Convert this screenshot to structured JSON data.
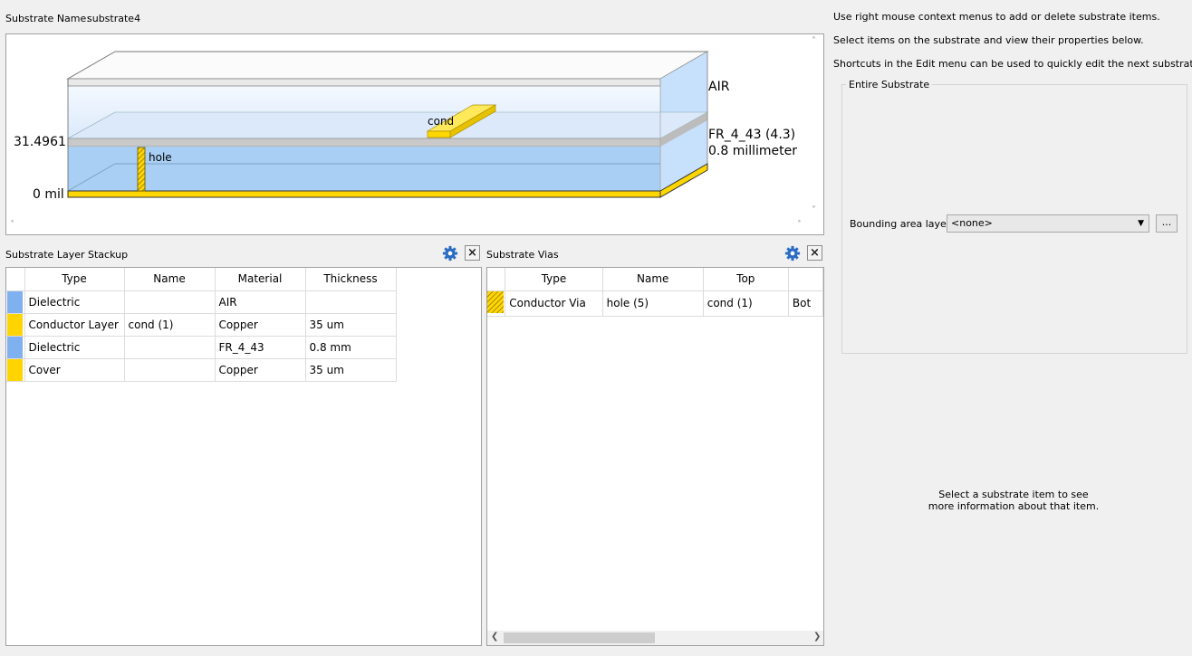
{
  "substrate_name_label": "Substrate Name:",
  "substrate_name": "substrate4",
  "viewer": {
    "layers": {
      "air": "AIR",
      "fr4": "FR_4_43 (4.3)",
      "fr4_thickness": "0.8 millimeter"
    },
    "axis": {
      "top": "31.4961",
      "bottom": "0 mil"
    },
    "items": {
      "cond": "cond",
      "hole": "hole"
    },
    "colors": {
      "conductor": "#ffd700",
      "dielectric": "#a9cff5",
      "air": "#e8f2fd"
    }
  },
  "hints": [
    "Use right mouse context menus to add or delete substrate items.",
    "Select items on the substrate and view their properties below.",
    "Shortcuts in the Edit menu can be used to quickly edit the next substrate item."
  ],
  "stackup": {
    "title": "Substrate Layer Stackup",
    "columns": [
      "Type",
      "Name",
      "Material",
      "Thickness"
    ],
    "rows": [
      {
        "color": "#7fb0f0",
        "type": "Dielectric",
        "name": "",
        "material": "AIR",
        "thickness": ""
      },
      {
        "color": "#ffd400",
        "type": "Conductor Layer",
        "name": "cond (1)",
        "material": "Copper",
        "thickness": "35 um"
      },
      {
        "color": "#7fb0f0",
        "type": "Dielectric",
        "name": "",
        "material": "FR_4_43",
        "thickness": "0.8 mm"
      },
      {
        "color": "#ffd400",
        "type": "Cover",
        "name": "",
        "material": "Copper",
        "thickness": "35 um"
      }
    ]
  },
  "vias": {
    "title": "Substrate Vias",
    "columns": [
      "Type",
      "Name",
      "Top",
      "Bot"
    ],
    "rows": [
      {
        "type": "Conductor Via",
        "name": "hole (5)",
        "top": "cond (1)",
        "bottom": "Bot"
      }
    ]
  },
  "properties": {
    "group_title": "Entire Substrate",
    "bounding_label": "Bounding area layer:",
    "bounding_value": "<none>",
    "browse_label": "...",
    "info_line1": "Select a substrate item to see",
    "info_line2": "more information about that item."
  }
}
